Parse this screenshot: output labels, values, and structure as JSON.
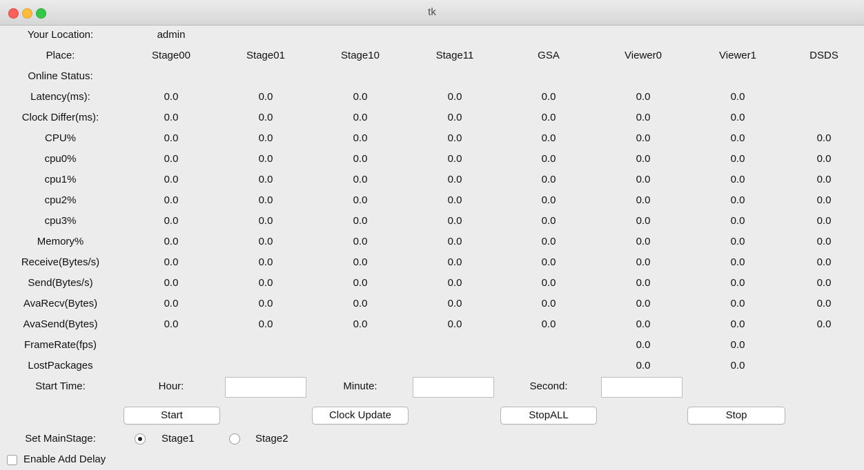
{
  "window": {
    "title": "tk"
  },
  "location": {
    "label": "Your Location:",
    "value": "admin"
  },
  "place": {
    "label": "Place:",
    "columns": [
      "Stage00",
      "Stage01",
      "Stage10",
      "Stage11",
      "GSA",
      "Viewer0",
      "Viewer1",
      "DSDS"
    ]
  },
  "online_status": {
    "label": "Online Status:"
  },
  "metrics": [
    {
      "label": "Latency(ms):",
      "values": [
        "0.0",
        "0.0",
        "0.0",
        "0.0",
        "0.0",
        "0.0",
        "0.0",
        ""
      ]
    },
    {
      "label": "Clock Differ(ms):",
      "values": [
        "0.0",
        "0.0",
        "0.0",
        "0.0",
        "0.0",
        "0.0",
        "0.0",
        ""
      ]
    },
    {
      "label": "CPU%",
      "values": [
        "0.0",
        "0.0",
        "0.0",
        "0.0",
        "0.0",
        "0.0",
        "0.0",
        "0.0"
      ]
    },
    {
      "label": "cpu0%",
      "values": [
        "0.0",
        "0.0",
        "0.0",
        "0.0",
        "0.0",
        "0.0",
        "0.0",
        "0.0"
      ]
    },
    {
      "label": "cpu1%",
      "values": [
        "0.0",
        "0.0",
        "0.0",
        "0.0",
        "0.0",
        "0.0",
        "0.0",
        "0.0"
      ]
    },
    {
      "label": "cpu2%",
      "values": [
        "0.0",
        "0.0",
        "0.0",
        "0.0",
        "0.0",
        "0.0",
        "0.0",
        "0.0"
      ]
    },
    {
      "label": "cpu3%",
      "values": [
        "0.0",
        "0.0",
        "0.0",
        "0.0",
        "0.0",
        "0.0",
        "0.0",
        "0.0"
      ]
    },
    {
      "label": "Memory%",
      "values": [
        "0.0",
        "0.0",
        "0.0",
        "0.0",
        "0.0",
        "0.0",
        "0.0",
        "0.0"
      ]
    },
    {
      "label": "Receive(Bytes/s)",
      "values": [
        "0.0",
        "0.0",
        "0.0",
        "0.0",
        "0.0",
        "0.0",
        "0.0",
        "0.0"
      ]
    },
    {
      "label": "Send(Bytes/s)",
      "values": [
        "0.0",
        "0.0",
        "0.0",
        "0.0",
        "0.0",
        "0.0",
        "0.0",
        "0.0"
      ]
    },
    {
      "label": "AvaRecv(Bytes)",
      "values": [
        "0.0",
        "0.0",
        "0.0",
        "0.0",
        "0.0",
        "0.0",
        "0.0",
        "0.0"
      ]
    },
    {
      "label": "AvaSend(Bytes)",
      "values": [
        "0.0",
        "0.0",
        "0.0",
        "0.0",
        "0.0",
        "0.0",
        "0.0",
        "0.0"
      ]
    },
    {
      "label": "FrameRate(fps)",
      "values": [
        "",
        "",
        "",
        "",
        "",
        "0.0",
        "0.0",
        ""
      ]
    },
    {
      "label": "LostPackages",
      "values": [
        "",
        "",
        "",
        "",
        "",
        "0.0",
        "0.0",
        ""
      ]
    }
  ],
  "start_time": {
    "label": "Start Time:",
    "hour_label": "Hour:",
    "hour_value": "",
    "minute_label": "Minute:",
    "minute_value": "",
    "second_label": "Second:",
    "second_value": ""
  },
  "buttons": {
    "start": "Start",
    "clock_update": "Clock Update",
    "stop_all": "StopALL",
    "stop": "Stop"
  },
  "main_stage": {
    "label": "Set MainStage:",
    "options": [
      "Stage1",
      "Stage2"
    ],
    "selected": "Stage1"
  },
  "enable_add_delay": {
    "label": "Enable Add Delay",
    "checked": false
  }
}
